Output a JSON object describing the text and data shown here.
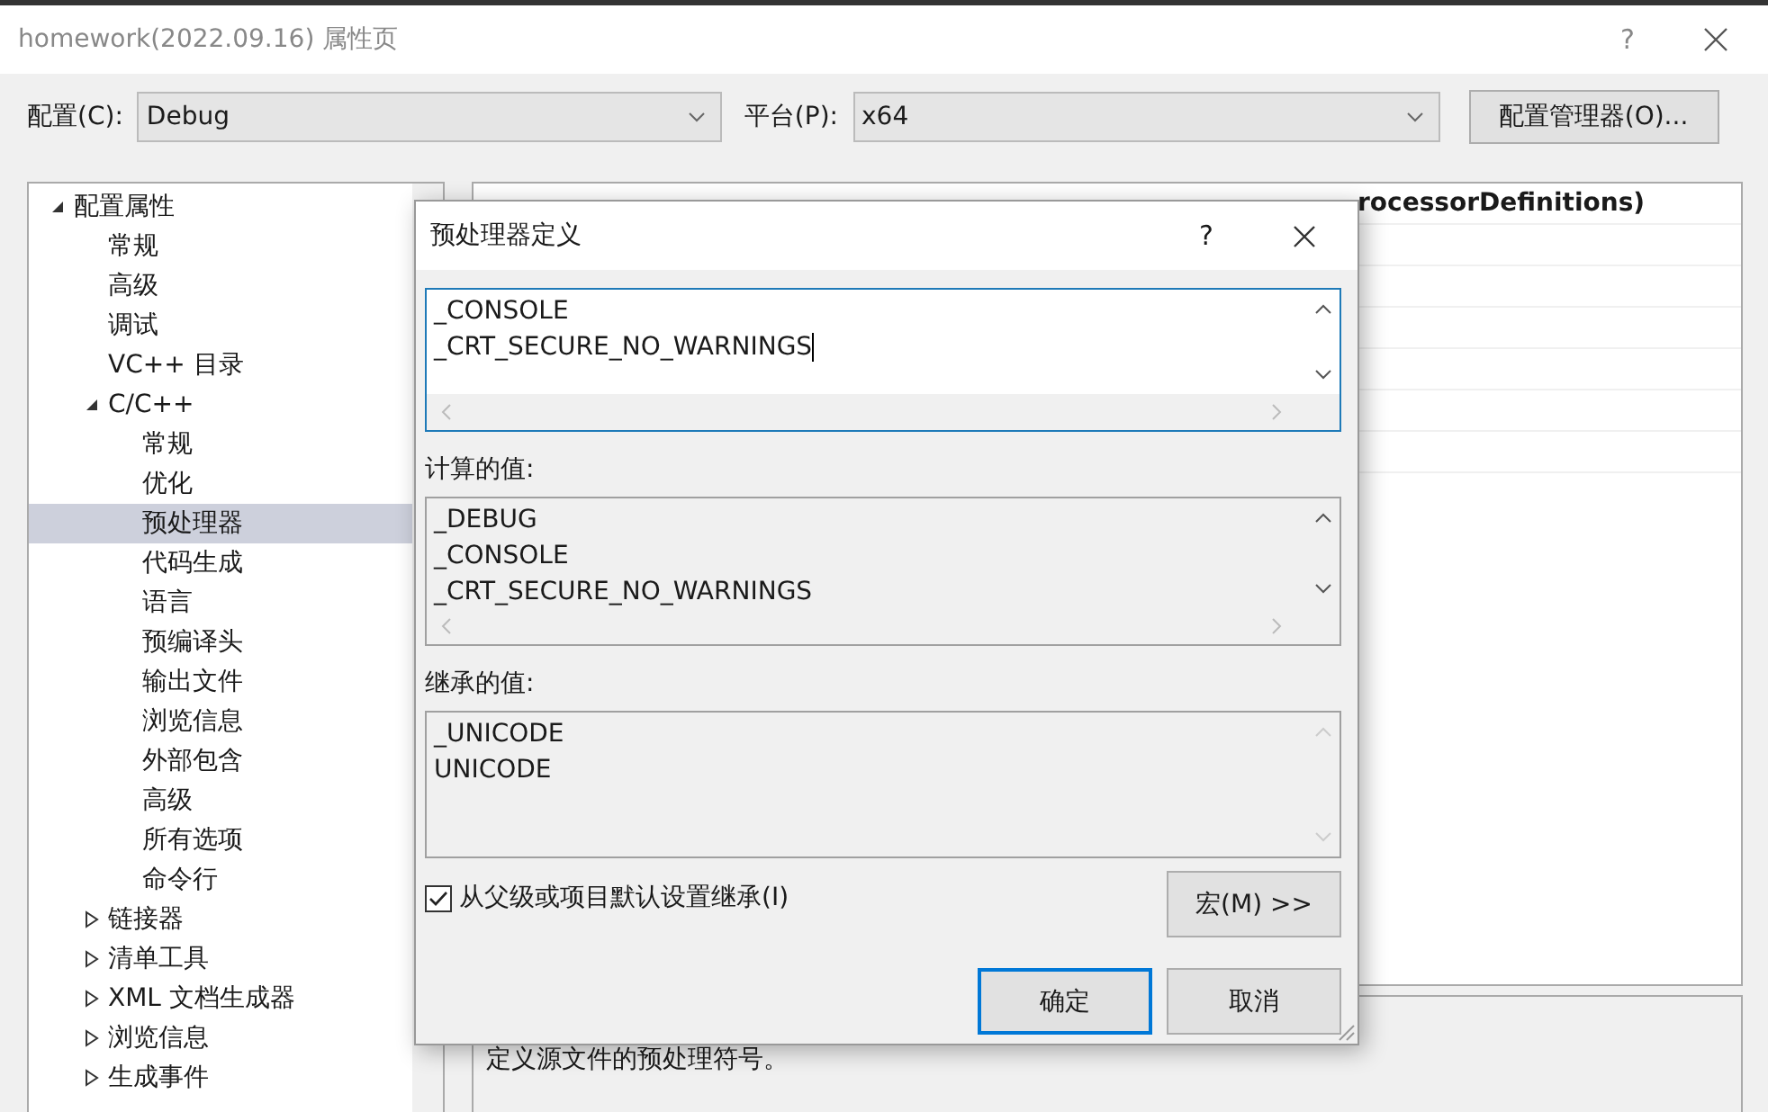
{
  "window": {
    "title": "homework(2022.09.16) 属性页",
    "help": "?"
  },
  "config": {
    "label": "配置(C):",
    "value": "Debug"
  },
  "platform": {
    "label": "平台(P):",
    "value": "x64"
  },
  "config_manager_button": "配置管理器(O)...",
  "tree": [
    {
      "label": "配置属性",
      "expanded": true,
      "selected": false,
      "children": [
        {
          "label": "常规",
          "selected": false
        },
        {
          "label": "高级",
          "selected": false
        },
        {
          "label": "调试",
          "selected": false
        },
        {
          "label": "VC++ 目录",
          "selected": false
        },
        {
          "label": "C/C++",
          "expanded": true,
          "selected": false,
          "children": [
            {
              "label": "常规",
              "selected": false
            },
            {
              "label": "优化",
              "selected": false
            },
            {
              "label": "预处理器",
              "selected": true
            },
            {
              "label": "代码生成",
              "selected": false
            },
            {
              "label": "语言",
              "selected": false
            },
            {
              "label": "预编译头",
              "selected": false
            },
            {
              "label": "输出文件",
              "selected": false
            },
            {
              "label": "浏览信息",
              "selected": false
            },
            {
              "label": "外部包含",
              "selected": false
            },
            {
              "label": "高级",
              "selected": false
            },
            {
              "label": "所有选项",
              "selected": false
            },
            {
              "label": "命令行",
              "selected": false
            }
          ]
        },
        {
          "label": "链接器",
          "expanded": false,
          "selected": false
        },
        {
          "label": "清单工具",
          "expanded": false,
          "selected": false
        },
        {
          "label": "XML 文档生成器",
          "expanded": false,
          "selected": false
        },
        {
          "label": "浏览信息",
          "expanded": false,
          "selected": false
        },
        {
          "label": "生成事件",
          "expanded": false,
          "selected": false
        }
      ]
    }
  ],
  "property_grid": {
    "value_visible": "rocessorDefinitions)"
  },
  "description": "定义源文件的预处理符号。",
  "dialog": {
    "title": "预处理器定义",
    "help": "?",
    "definitions": [
      "_CONSOLE",
      "_CRT_SECURE_NO_WARNINGS"
    ],
    "computed_label": "计算的值:",
    "computed": [
      "_DEBUG",
      "_CONSOLE",
      "_CRT_SECURE_NO_WARNINGS"
    ],
    "inherited_label": "继承的值:",
    "inherited": [
      "_UNICODE",
      "UNICODE"
    ],
    "inherit_checkbox": {
      "label": "从父级或项目默认设置继承(I)",
      "checked": true
    },
    "macros_button": "宏(M) >>",
    "buttons": [
      {
        "label": "确定",
        "default": true
      },
      {
        "label": "取消",
        "default": false
      }
    ]
  }
}
